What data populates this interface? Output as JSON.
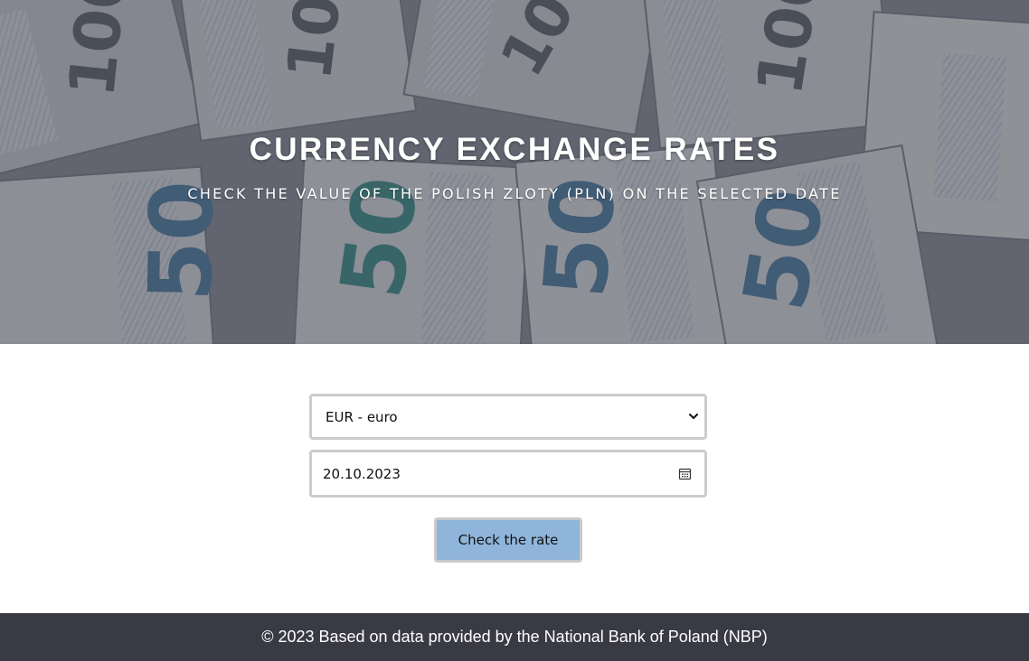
{
  "hero": {
    "title": "CURRENCY EXCHANGE RATES",
    "subtitle": "CHECK THE VALUE OF THE POLISH ZLOTY (PLN) ON THE SELECTED DATE",
    "background": "banknotes-photo"
  },
  "form": {
    "currency_select": {
      "selected": "EUR - euro",
      "icon": "chevron-down-icon"
    },
    "date_input": {
      "value": "20.10.2023",
      "icon": "calendar-icon"
    },
    "submit_label": "Check the rate"
  },
  "footer": {
    "text": "© 2023 Based on data provided by the National Bank of Poland (NBP)"
  },
  "colors": {
    "button_bg": "#8fb5da",
    "footer_bg": "#393a44",
    "field_border": "#cccccc"
  }
}
